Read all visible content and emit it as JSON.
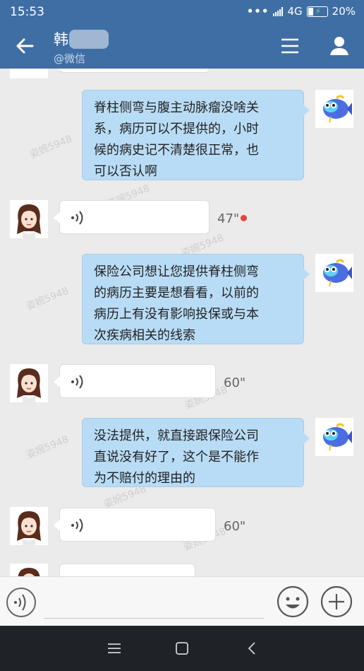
{
  "status_bar": {
    "time": "15:53",
    "dots": "•••",
    "network": "4G",
    "battery": "20%"
  },
  "header": {
    "title": "韩",
    "subtitle": "@微信",
    "accent_color": "#3f6ea5"
  },
  "watermark": "姿婉5948",
  "messages": [
    {
      "side": "right",
      "type": "text",
      "lines": [
        "脊柱侧弯与腹主动脉瘤没啥关",
        "系，病历可以不提供的，小时",
        "候的病史记不清楚很正常，也",
        "可以否认啊"
      ]
    },
    {
      "side": "left",
      "type": "voice",
      "duration": "47\"",
      "unread": true
    },
    {
      "side": "right",
      "type": "text",
      "lines": [
        "保险公司想让您提供脊柱侧弯",
        "的病历主要是想看看，以前的",
        "病历上有没有影响投保或与本",
        "次疾病相关的线索"
      ]
    },
    {
      "side": "left",
      "type": "voice",
      "duration": "60\"",
      "unread": false
    },
    {
      "side": "right",
      "type": "text",
      "lines": [
        "没法提供，就直接跟保险公司",
        "直说没有好了，这个是不能作",
        "为不赔付的理由的"
      ]
    },
    {
      "side": "left",
      "type": "voice",
      "duration": "60\"",
      "unread": false
    }
  ],
  "input_bar": {
    "voice_icon": "voice-input-icon",
    "emoji_icon": "emoji-icon",
    "plus_icon": "plus-icon"
  },
  "nav_bar": {
    "icons": [
      "menu-icon",
      "home-icon",
      "back-icon"
    ]
  },
  "colors": {
    "bubble_right": "#b9dcf6",
    "bubble_left": "#ffffff",
    "background": "#ebebeb",
    "unread_dot": "#e64340"
  }
}
